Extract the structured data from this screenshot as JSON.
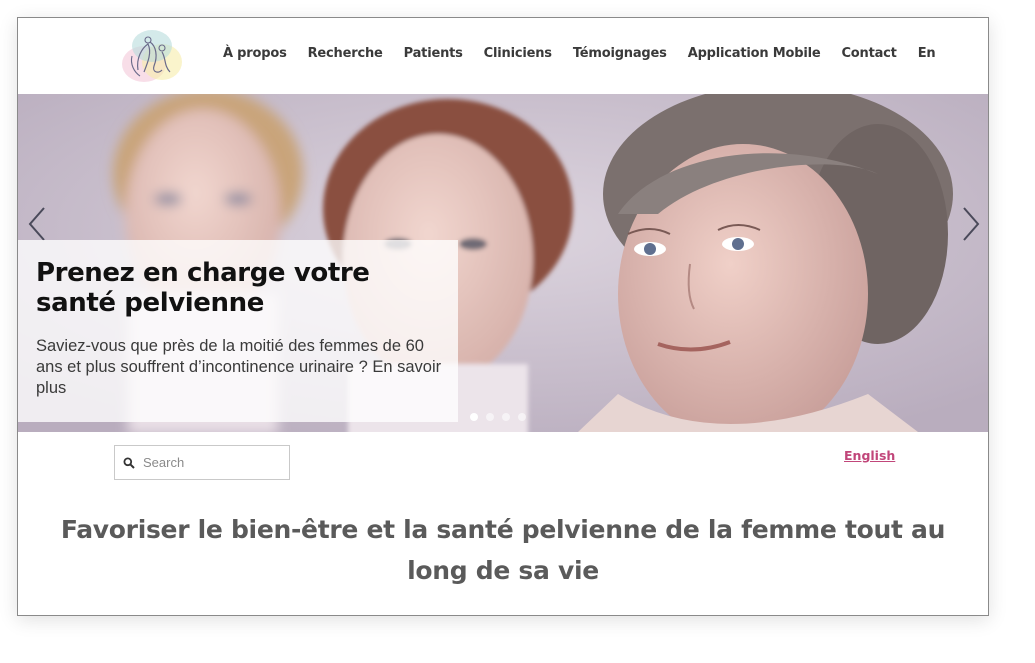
{
  "header": {
    "nav": [
      {
        "label": "À propos"
      },
      {
        "label": "Recherche"
      },
      {
        "label": "Patients"
      },
      {
        "label": "Cliniciens"
      },
      {
        "label": "Témoignages"
      },
      {
        "label": "Application Mobile"
      },
      {
        "label": "Contact"
      },
      {
        "label": "En"
      }
    ]
  },
  "hero": {
    "title": "Prenez en charge votre santé pelvienne",
    "text": "Saviez-vous que près de la moitié des femmes de 60 ans et plus souffrent d’incontinence urinaire ? En savoir plus",
    "slides": 4,
    "active_slide": 1,
    "icons": {
      "prev": "chevron-left-icon",
      "next": "chevron-right-icon"
    }
  },
  "search": {
    "placeholder": "Search",
    "icon": "search-icon"
  },
  "language": {
    "label": "English"
  },
  "tagline": "Favoriser le bien-être et la santé pelvienne de la femme tout au long de sa vie",
  "colors": {
    "accent": "#c1467a",
    "nav_text": "#3a3a3a",
    "tagline": "#5a5a5a",
    "hero_bg": "#cfc5d3"
  }
}
